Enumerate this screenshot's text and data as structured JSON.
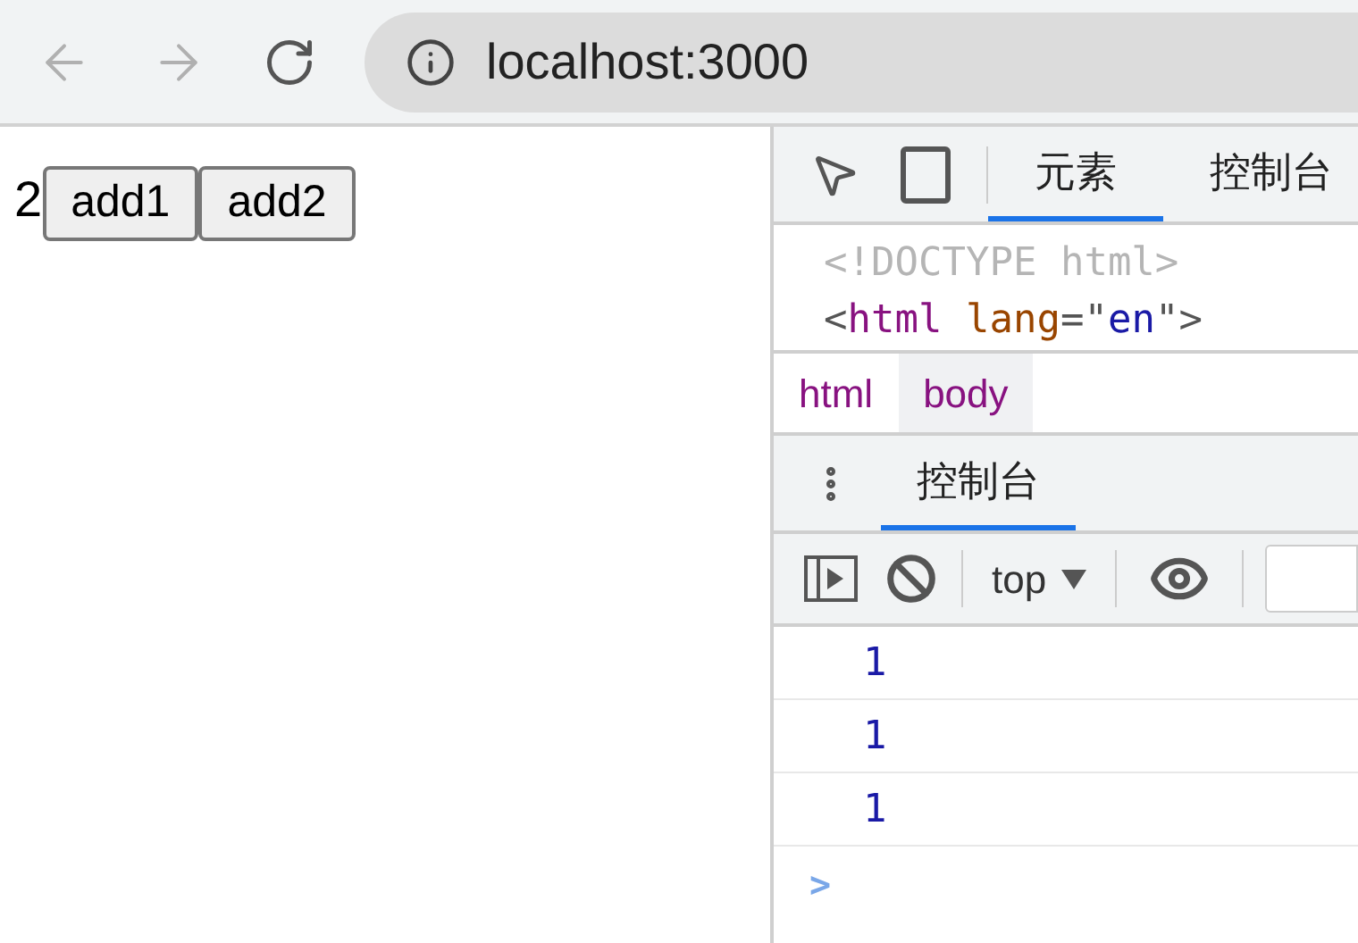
{
  "browser": {
    "address": "localhost:3000"
  },
  "page": {
    "count": "2",
    "buttons": [
      "add1",
      "add2"
    ]
  },
  "devtools": {
    "tabs": [
      {
        "label": "元素",
        "selected": true
      },
      {
        "label": "控制台",
        "selected": false
      }
    ],
    "elements": {
      "doctype": "<!DOCTYPE html>",
      "html_tag": {
        "open": "<",
        "name": "html",
        "attribute": "lang",
        "equals": "=\"",
        "value": "en",
        "close": "\">"
      }
    },
    "breadcrumbs": [
      {
        "label": "html",
        "selected": false
      },
      {
        "label": "body",
        "selected": true
      }
    ],
    "drawer_tabs": [
      {
        "label": "控制台",
        "selected": true
      }
    ],
    "console": {
      "context": "top",
      "messages": [
        "1",
        "1",
        "1"
      ],
      "prompt": ">"
    }
  }
}
